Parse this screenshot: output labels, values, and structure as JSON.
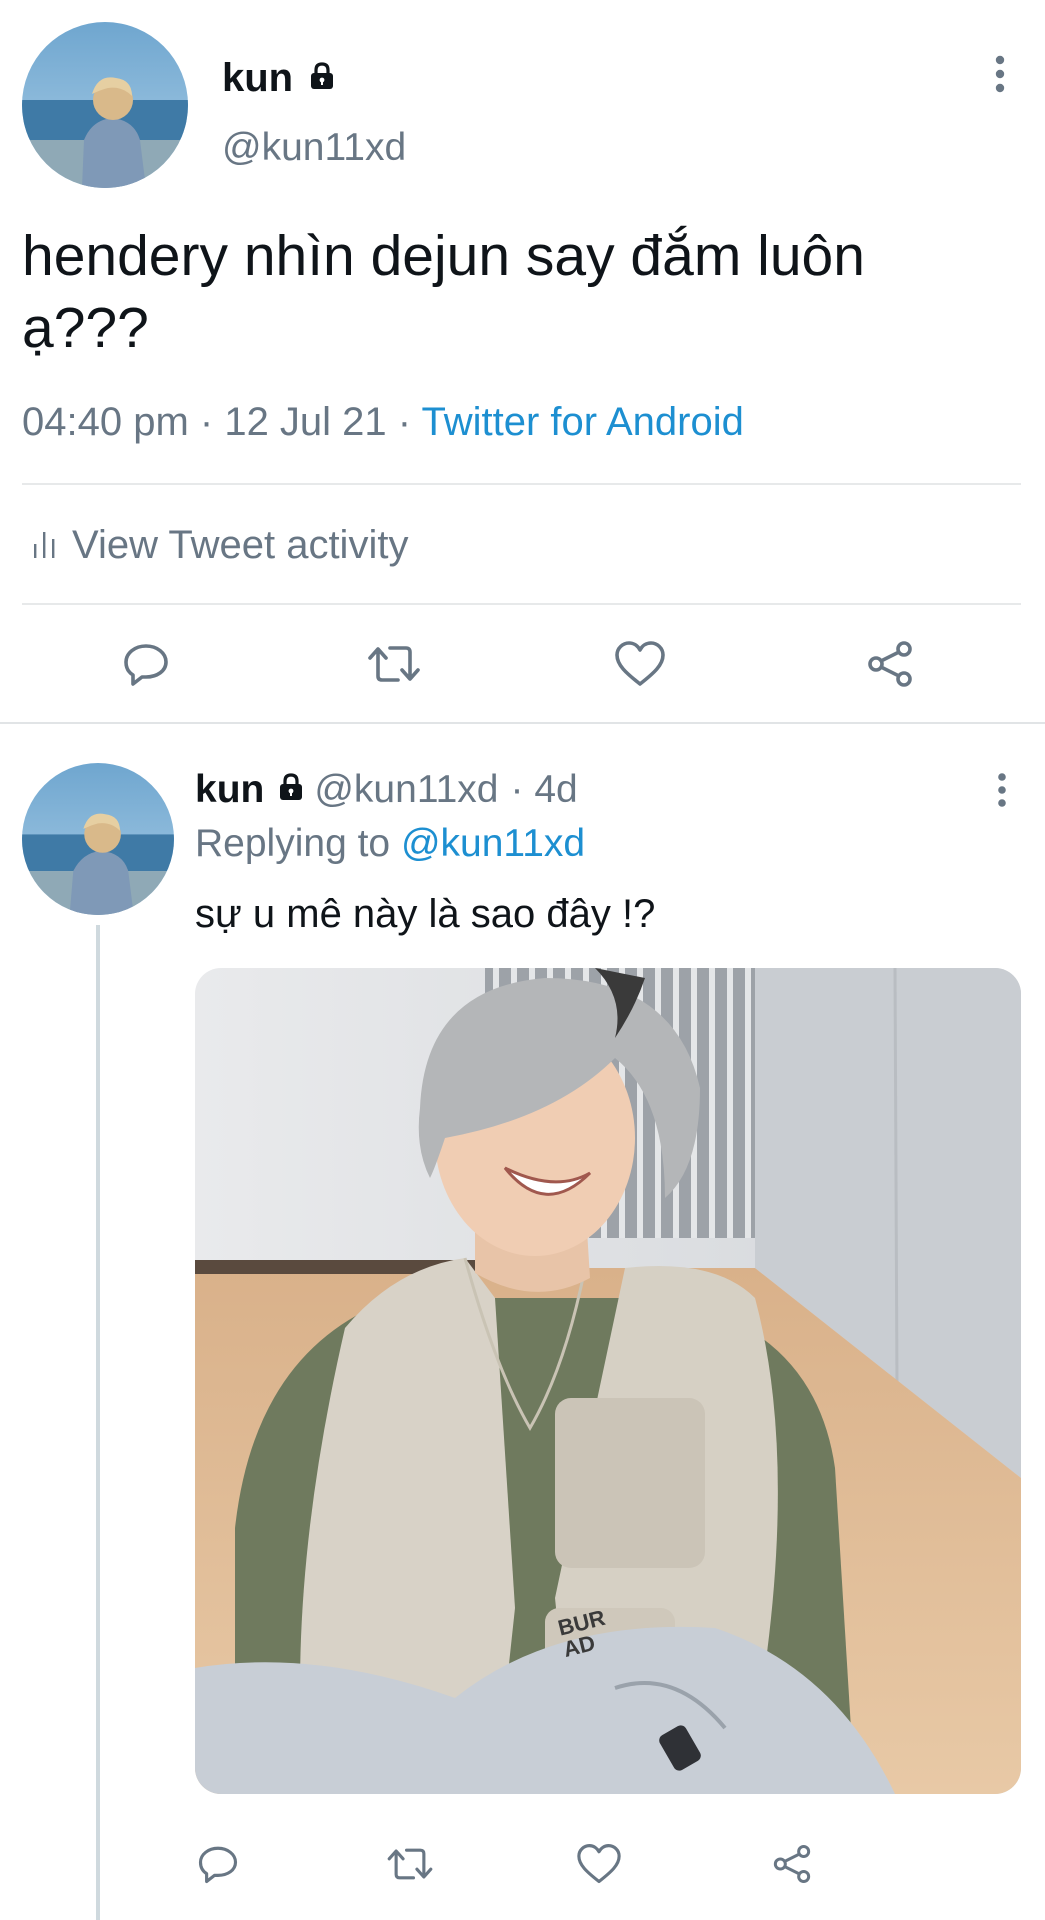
{
  "main_tweet": {
    "display_name": "kun",
    "handle": "@kun11xd",
    "text_line1": "hendery nhìn dejun say đắm luôn",
    "text_line2": "ạ???",
    "time": "04:40 pm",
    "sep1": " · ",
    "date": "12 Jul 21",
    "sep2": " · ",
    "source": "Twitter for Android",
    "activity_label": "View Tweet activity",
    "icons": [
      "more-vertical-icon",
      "lock-icon",
      "bar-chart-icon",
      "reply-icon",
      "retweet-icon",
      "heart-icon",
      "share-icon"
    ]
  },
  "reply_tweet": {
    "display_name": "kun",
    "handle": "@kun11xd",
    "age": "· 4d",
    "replying_prefix": "Replying to ",
    "replying_handle": "@kun11xd",
    "text": "sự u mê này là sao đây !?",
    "media_badge": "BUR\nAD"
  },
  "colors": {
    "accent": "#1d8fd1",
    "secondary_text": "#687684",
    "divider": "#e7e9ea",
    "thread_line": "#cfd9de"
  }
}
